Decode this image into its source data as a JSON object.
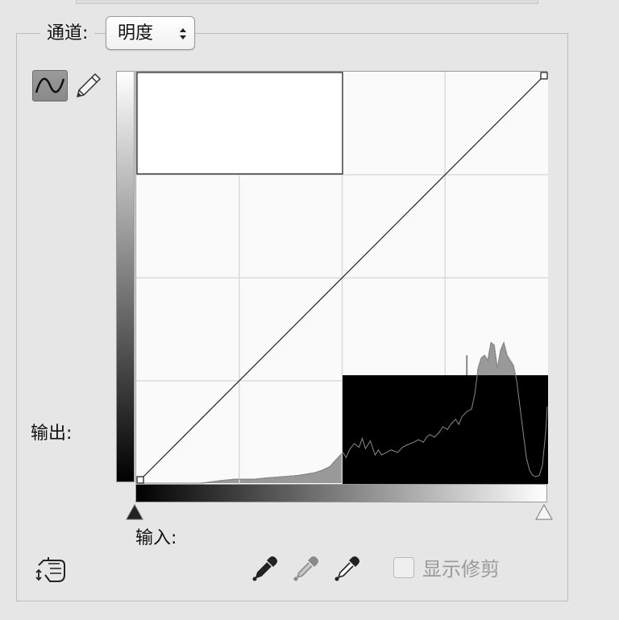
{
  "channel": {
    "label": "通道:",
    "selected": "明度"
  },
  "tools": {
    "curve_tool_active": true
  },
  "labels": {
    "output": "输出:",
    "input": "输入:"
  },
  "clipping": {
    "label": "显示修剪",
    "checked": false
  },
  "icons": {
    "curve_tool": "curve-icon",
    "pencil_tool": "pencil-icon",
    "targeted_adjust": "hand-pointer-icon",
    "black_point": "eyedropper-black-icon",
    "gray_point": "eyedropper-gray-icon",
    "white_point": "eyedropper-white-icon"
  },
  "curve": {
    "points": [
      [
        0,
        0
      ],
      [
        255,
        255
      ]
    ],
    "grid_divisions": 4
  },
  "histogram": {
    "levels": [
      [
        0,
        0
      ],
      [
        40,
        0
      ],
      [
        52,
        2
      ],
      [
        60,
        3
      ],
      [
        72,
        3
      ],
      [
        80,
        4
      ],
      [
        90,
        5
      ],
      [
        100,
        6
      ],
      [
        110,
        8
      ],
      [
        115,
        10
      ],
      [
        120,
        13
      ],
      [
        122,
        16
      ],
      [
        125,
        20
      ],
      [
        128,
        24
      ],
      [
        130,
        20
      ],
      [
        132,
        26
      ],
      [
        135,
        31
      ],
      [
        138,
        28
      ],
      [
        140,
        35
      ],
      [
        142,
        27
      ],
      [
        145,
        33
      ],
      [
        148,
        22
      ],
      [
        150,
        26
      ],
      [
        152,
        22
      ],
      [
        155,
        24
      ],
      [
        158,
        26
      ],
      [
        162,
        24
      ],
      [
        165,
        28
      ],
      [
        168,
        30
      ],
      [
        172,
        32
      ],
      [
        175,
        34
      ],
      [
        178,
        32
      ],
      [
        180,
        36
      ],
      [
        182,
        38
      ],
      [
        185,
        36
      ],
      [
        188,
        40
      ],
      [
        190,
        44
      ],
      [
        193,
        42
      ],
      [
        195,
        46
      ],
      [
        198,
        50
      ],
      [
        200,
        46
      ],
      [
        202,
        52
      ],
      [
        205,
        56
      ],
      [
        208,
        58
      ],
      [
        210,
        70
      ],
      [
        212,
        90
      ],
      [
        214,
        98
      ],
      [
        216,
        100
      ],
      [
        218,
        96
      ],
      [
        220,
        110
      ],
      [
        222,
        108
      ],
      [
        224,
        90
      ],
      [
        226,
        104
      ],
      [
        228,
        110
      ],
      [
        230,
        100
      ],
      [
        232,
        96
      ],
      [
        234,
        92
      ],
      [
        236,
        80
      ],
      [
        238,
        60
      ],
      [
        240,
        40
      ],
      [
        242,
        20
      ],
      [
        244,
        10
      ],
      [
        246,
        6
      ],
      [
        248,
        5
      ],
      [
        250,
        6
      ],
      [
        252,
        14
      ],
      [
        254,
        40
      ],
      [
        255,
        60
      ]
    ],
    "midtone_spike": 205,
    "colors": {
      "fill": "#999999",
      "line": "#555555",
      "grid": "#d9d9d9",
      "curve": "#1e1e1e"
    }
  },
  "sliders": {
    "black_input": 0,
    "white_input": 255
  }
}
